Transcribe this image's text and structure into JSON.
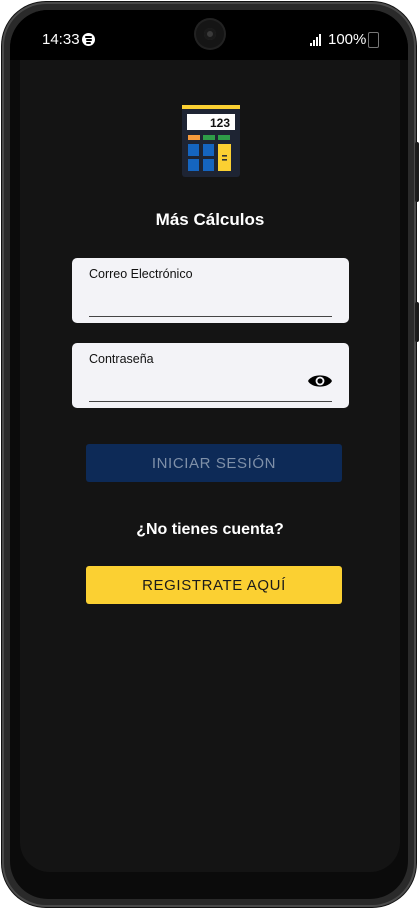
{
  "status_bar": {
    "time": "14:33",
    "battery_text": "100%",
    "icons": [
      "spotify-icon",
      "signal-icon",
      "battery-icon"
    ]
  },
  "app": {
    "logo_icon": "calculator-icon",
    "logo_display": "123",
    "title": "Más Cálculos"
  },
  "login_form": {
    "email": {
      "label": "Correo Electrónico",
      "value": ""
    },
    "password": {
      "label": "Contraseña",
      "value": "",
      "toggle_icon": "eye-icon"
    },
    "login_button": "INICIAR SESIÓN"
  },
  "register": {
    "question": "¿No tienes cuenta?",
    "button": "REGISTRATE AQUÍ"
  },
  "colors": {
    "background": "#141414",
    "login_button_bg": "#0d2a57",
    "register_button_bg": "#fbd032",
    "field_bg": "#f3f3f7"
  }
}
